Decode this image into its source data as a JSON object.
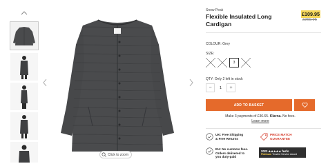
{
  "gallery": {
    "zoom_label": "Click to zoom",
    "thumb_count": 5
  },
  "product": {
    "brand": "Snow Peak",
    "title": "Flexible Insulated Long Cardigan",
    "price_now": "£109.95",
    "price_was": "£269.95",
    "colour_label": "COLOUR: Grey",
    "size_label": "SIZE:",
    "sizes": [
      {
        "label": "",
        "available": false
      },
      {
        "label": "",
        "available": false
      },
      {
        "label": "3",
        "available": true,
        "selected": true
      },
      {
        "label": "",
        "available": false
      }
    ],
    "qty_label": "QTY: Only 2 left in stock",
    "qty_value": "1",
    "qty_minus": "−",
    "qty_plus": "+",
    "add_to_basket": "ADD TO BASKET"
  },
  "klarna": {
    "prefix": "Make 3 payments of £36.65.",
    "brand": "Klarna.",
    "suffix": "No fees.",
    "learn_more": "Learn more"
  },
  "badges": {
    "shipping_line1": "UK: Free Shipping",
    "shipping_line2": "& Free Returns",
    "price_match_line1": "PRICE MATCH",
    "price_match_line2": "GUARANTEE",
    "eu_line1": "EU: No customs fees.",
    "eu_line2": "Orders delivered to",
    "eu_line3": "you duty-paid",
    "feefo_top": "2023 ★★★★★ feefo",
    "feefo_bottom_strong": "Platinum",
    "feefo_bottom": "Trusted Service Award"
  },
  "colors": {
    "accent": "#e56a2b",
    "sale_highlight": "#f6d75a",
    "garment": "#4a4b4d",
    "price_match": "#d53a2a"
  }
}
